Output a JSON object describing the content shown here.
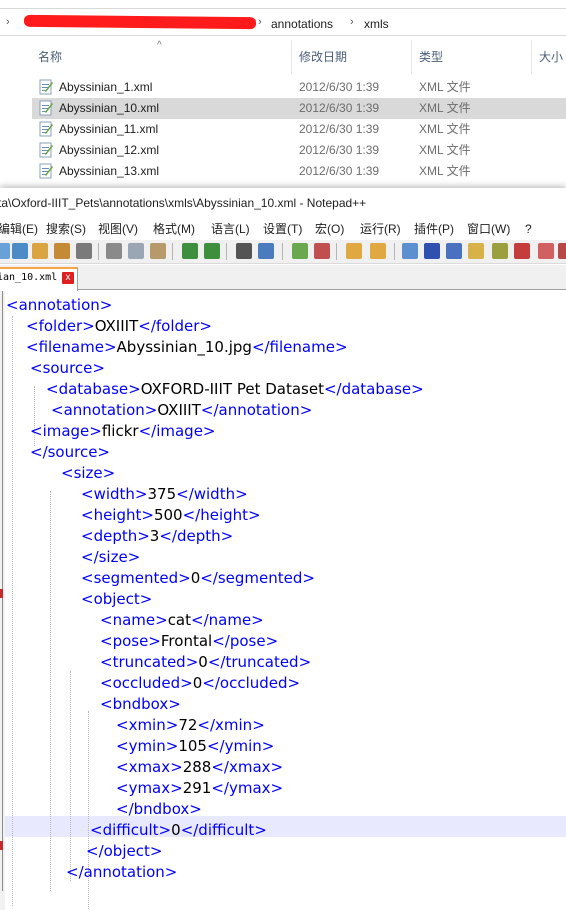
{
  "explorer": {
    "breadcrumb": [
      "annotations",
      "xmls"
    ],
    "columns": {
      "name": "名称",
      "date": "修改日期",
      "type": "类型",
      "size": "大小"
    },
    "files": [
      {
        "name": "Abyssinian_1.xml",
        "date": "2012/6/30 1:39",
        "type": "XML 文件",
        "selected": false
      },
      {
        "name": "Abyssinian_10.xml",
        "date": "2012/6/30 1:39",
        "type": "XML 文件",
        "selected": true
      },
      {
        "name": "Abyssinian_11.xml",
        "date": "2012/6/30 1:39",
        "type": "XML 文件",
        "selected": false
      },
      {
        "name": "Abyssinian_12.xml",
        "date": "2012/6/30 1:39",
        "type": "XML 文件",
        "selected": false
      },
      {
        "name": "Abyssinian_13.xml",
        "date": "2012/6/30 1:39",
        "type": "XML 文件",
        "selected": false
      }
    ],
    "icons": {
      "file": "xml-file-icon",
      "sort": "sort-up-arrow-icon",
      "chevron": "chevron-right-icon"
    }
  },
  "npp": {
    "title": "ta\\Oxford-IIIT_Pets\\annotations\\xmls\\Abyssinian_10.xml - Notepad++",
    "menus": [
      "编辑(E)",
      "搜索(S)",
      "视图(V)",
      "格式(M)",
      "语言(L)",
      "设置(T)",
      "宏(O)",
      "运行(R)",
      "插件(P)",
      "窗口(W)",
      "?"
    ],
    "tab": {
      "label": "ian_10.xml",
      "close": "x"
    },
    "accent_color": "#f7a54a",
    "tag_color": "#0000ff"
  },
  "code": {
    "annotation_open": "<annotation>",
    "folder_open": "<folder>",
    "folder_val": "OXIIIT",
    "folder_close": "</folder>",
    "filename_open": "<filename>",
    "filename_val": "Abyssinian_10.jpg",
    "filename_close": "</filename>",
    "source_open": "<source>",
    "database_open": "<database>",
    "database_val": "OXFORD-IIIT Pet Dataset",
    "database_close": "</database>",
    "annotation2_open": "<annotation>",
    "annotation2_val": "OXIIIT",
    "annotation2_close": "</annotation>",
    "image_open": "<image>",
    "image_val": "flickr",
    "image_close": "</image>",
    "source_close": "</source>",
    "size_open": "<size>",
    "width_open": "<width>",
    "width_val": "375",
    "width_close": "</width>",
    "height_open": "<height>",
    "height_val": "500",
    "height_close": "</height>",
    "depth_open": "<depth>",
    "depth_val": "3",
    "depth_close": "</depth>",
    "size_close": "</size>",
    "segmented_open": "<segmented>",
    "segmented_val": "0",
    "segmented_close": "</segmented>",
    "object_open": "<object>",
    "name_open": "<name>",
    "name_val": "cat",
    "name_close": "</name>",
    "pose_open": "<pose>",
    "pose_val": "Frontal",
    "pose_close": "</pose>",
    "truncated_open": "<truncated>",
    "truncated_val": "0",
    "truncated_close": "</truncated>",
    "occluded_open": "<occluded>",
    "occluded_val": "0",
    "occluded_close": "</occluded>",
    "bndbox_open": "<bndbox>",
    "xmin_open": "<xmin>",
    "xmin_val": "72",
    "xmin_close": "</xmin>",
    "ymin_open": "<ymin>",
    "ymin_val": "105",
    "ymin_close": "</ymin>",
    "xmax_open": "<xmax>",
    "xmax_val": "288",
    "xmax_close": "</xmax>",
    "ymax_open": "<ymax>",
    "ymax_val": "291",
    "ymax_close": "</ymax>",
    "bndbox_close": "</bndbox>",
    "difficult_open": "<difficult>",
    "difficult_val": "0",
    "difficult_close": "</difficult>",
    "object_close": "</object>",
    "annotation_close": "</annotation>"
  }
}
